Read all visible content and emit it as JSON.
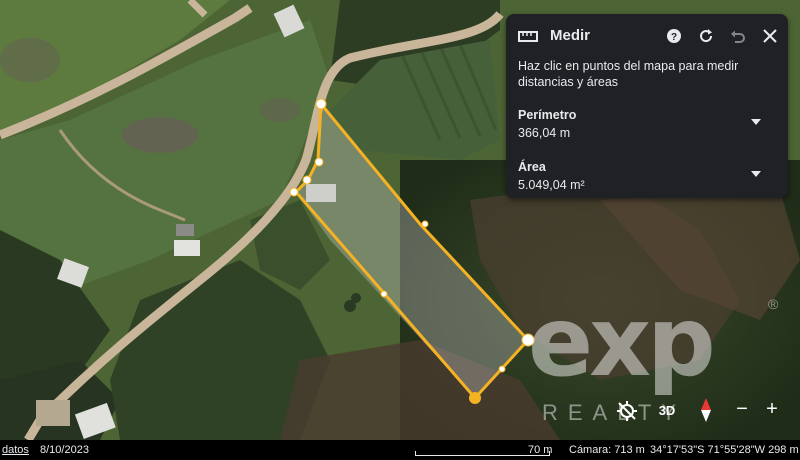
{
  "panel": {
    "title": "Medir",
    "hint": "Haz clic en puntos del mapa para medir distancias y áreas",
    "perimeter_label": "Perímetro",
    "perimeter_value": "366,04 m",
    "area_label": "Área",
    "area_value": "5.049,04 m²"
  },
  "controls": {
    "view_3d_label": "3D",
    "zoom_out_label": "−",
    "zoom_in_label": "+"
  },
  "watermark": {
    "brand": "exp",
    "tagline": "REALTY",
    "reg": "®"
  },
  "status_bar": {
    "data_label": "datos",
    "date": "8/10/2023",
    "scale_label": "70 m",
    "camera": "Cámara: 713 m",
    "coordinates": "34°17'53\"S 71°55'28\"W",
    "elevation": "298 m"
  },
  "colors": {
    "measure_line": "#f5b324",
    "panel_bg": "#202124",
    "panel_text": "#e8eaed"
  }
}
